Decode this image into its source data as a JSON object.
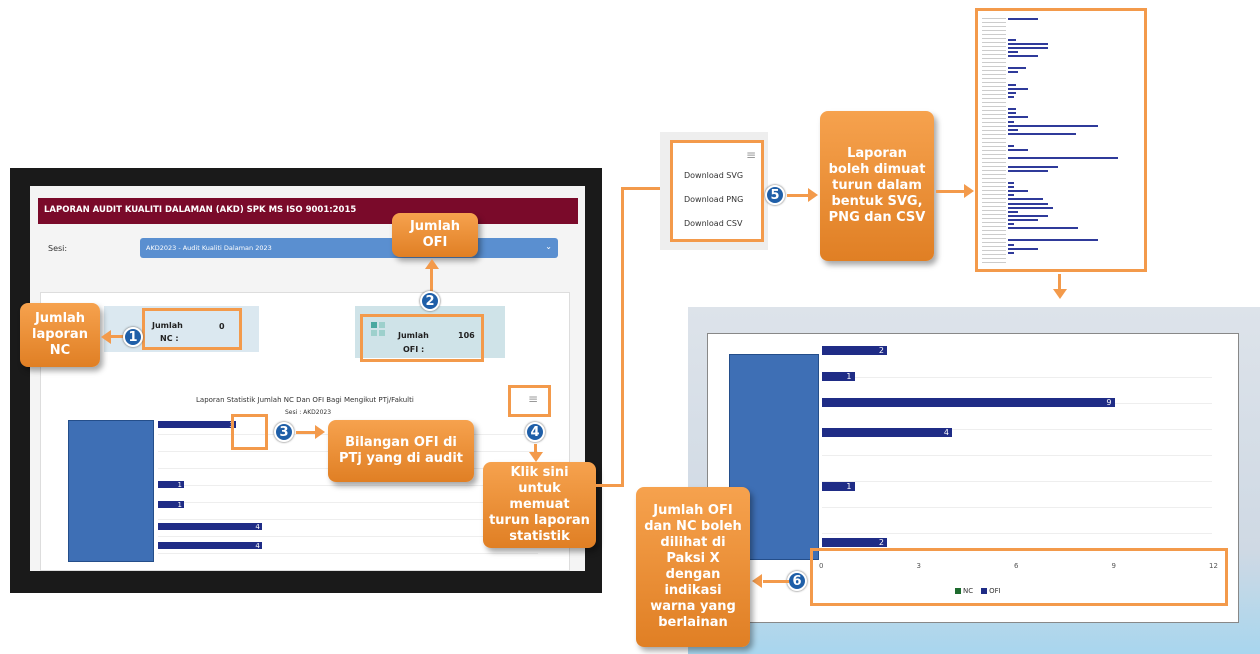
{
  "left_screen": {
    "header_title": "LAPORAN AUDIT KUALITI DALAMAN (AKD) SPK MS ISO 9001:2015",
    "session_label": "Sesi:",
    "session_value": "AKD2023 - Audit Kualiti Dalaman 2023",
    "nc_card": {
      "label1": "Jumlah",
      "label2": "NC :",
      "value": "0"
    },
    "ofi_card": {
      "label1": "Jumlah",
      "label2": "OFI :",
      "value": "106"
    },
    "chart_title": "Laporan Statistik Jumlah NC Dan OFI Bagi Mengikut PTj/Fakulti",
    "chart_subtitle": "Sesi : AKD2023"
  },
  "download_menu": {
    "items": [
      "Download SVG",
      "Download PNG",
      "Download CSV"
    ]
  },
  "zoom_chart": {
    "x_ticks": [
      "0",
      "3",
      "6",
      "9",
      "12"
    ],
    "legend": [
      {
        "name": "NC",
        "color": "#1e6b2e"
      },
      {
        "name": "OFI",
        "color": "#1f2c86"
      }
    ]
  },
  "callouts": {
    "c1": "Jumlah laporan NC",
    "c2": "Jumlah OFI",
    "c3": "Bilangan OFI di PTj yang di audit",
    "c4": "Klik sini untuk memuat turun laporan statistik",
    "c5": "Laporan boleh dimuat turun dalam bentuk SVG, PNG dan CSV",
    "c6": "Jumlah OFI dan NC boleh dilihat di Paksi X dengan indikasi warna yang berlainan"
  },
  "badges": [
    "1",
    "2",
    "3",
    "4",
    "5",
    "6"
  ],
  "chart_data": {
    "type": "bar",
    "orientation": "horizontal",
    "title": "Laporan Statistik Jumlah NC Dan OFI Bagi Mengikut PTj/Fakulti",
    "subtitle": "Sesi : AKD2023",
    "series": [
      {
        "name": "NC",
        "values": []
      },
      {
        "name": "OFI",
        "values": [
          2,
          1,
          9,
          4,
          1,
          2
        ]
      }
    ],
    "xlim": [
      0,
      12
    ],
    "x_ticks": [
      0,
      3,
      6,
      9,
      12
    ],
    "left_chart_visible_values": [
      3,
      1,
      1,
      4,
      4
    ],
    "legend": "bottom"
  },
  "colors": {
    "accent": "#f39a4b",
    "header": "#7a0a2a",
    "bar": "#1f2c86",
    "badge": "#1f5fa8"
  }
}
